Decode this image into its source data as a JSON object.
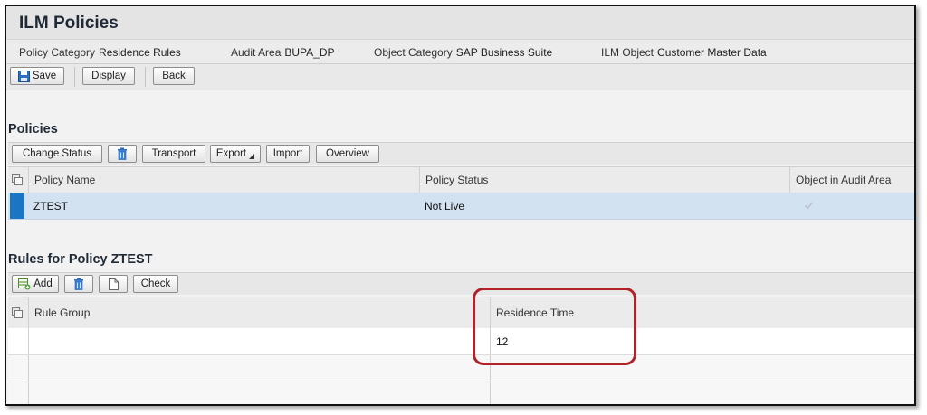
{
  "page": {
    "title": "ILM Policies"
  },
  "context": {
    "policy_category_label": "Policy Category",
    "policy_category_value": "Residence Rules",
    "audit_area_label": "Audit Area",
    "audit_area_value": "BUPA_DP",
    "object_category_label": "Object Category",
    "object_category_value": "SAP Business Suite",
    "ilm_object_label": "ILM Object",
    "ilm_object_value": "Customer Master Data"
  },
  "main_toolbar": {
    "save_label": "Save",
    "display_label": "Display",
    "back_label": "Back"
  },
  "policies": {
    "title": "Policies",
    "toolbar": {
      "change_status": "Change Status",
      "transport": "Transport",
      "export": "Export",
      "import": "Import",
      "overview": "Overview"
    },
    "columns": [
      "Policy Name",
      "Policy Status",
      "Object in Audit Area"
    ],
    "rows": [
      {
        "name": "ZTEST",
        "status": "Not Live",
        "in_audit_area": true
      }
    ]
  },
  "rules": {
    "title": "Rules for Policy ZTEST",
    "toolbar": {
      "add": "Add",
      "check": "Check"
    },
    "columns": [
      "Rule Group",
      "Residence Time"
    ],
    "rows": [
      {
        "rule_group": "",
        "residence_time": "12"
      },
      {
        "rule_group": "",
        "residence_time": ""
      },
      {
        "rule_group": "",
        "residence_time": ""
      }
    ]
  },
  "colors": {
    "selected_row": "#d3e2f1",
    "row_marker": "#1c74c4",
    "highlight": "#b1232a"
  }
}
